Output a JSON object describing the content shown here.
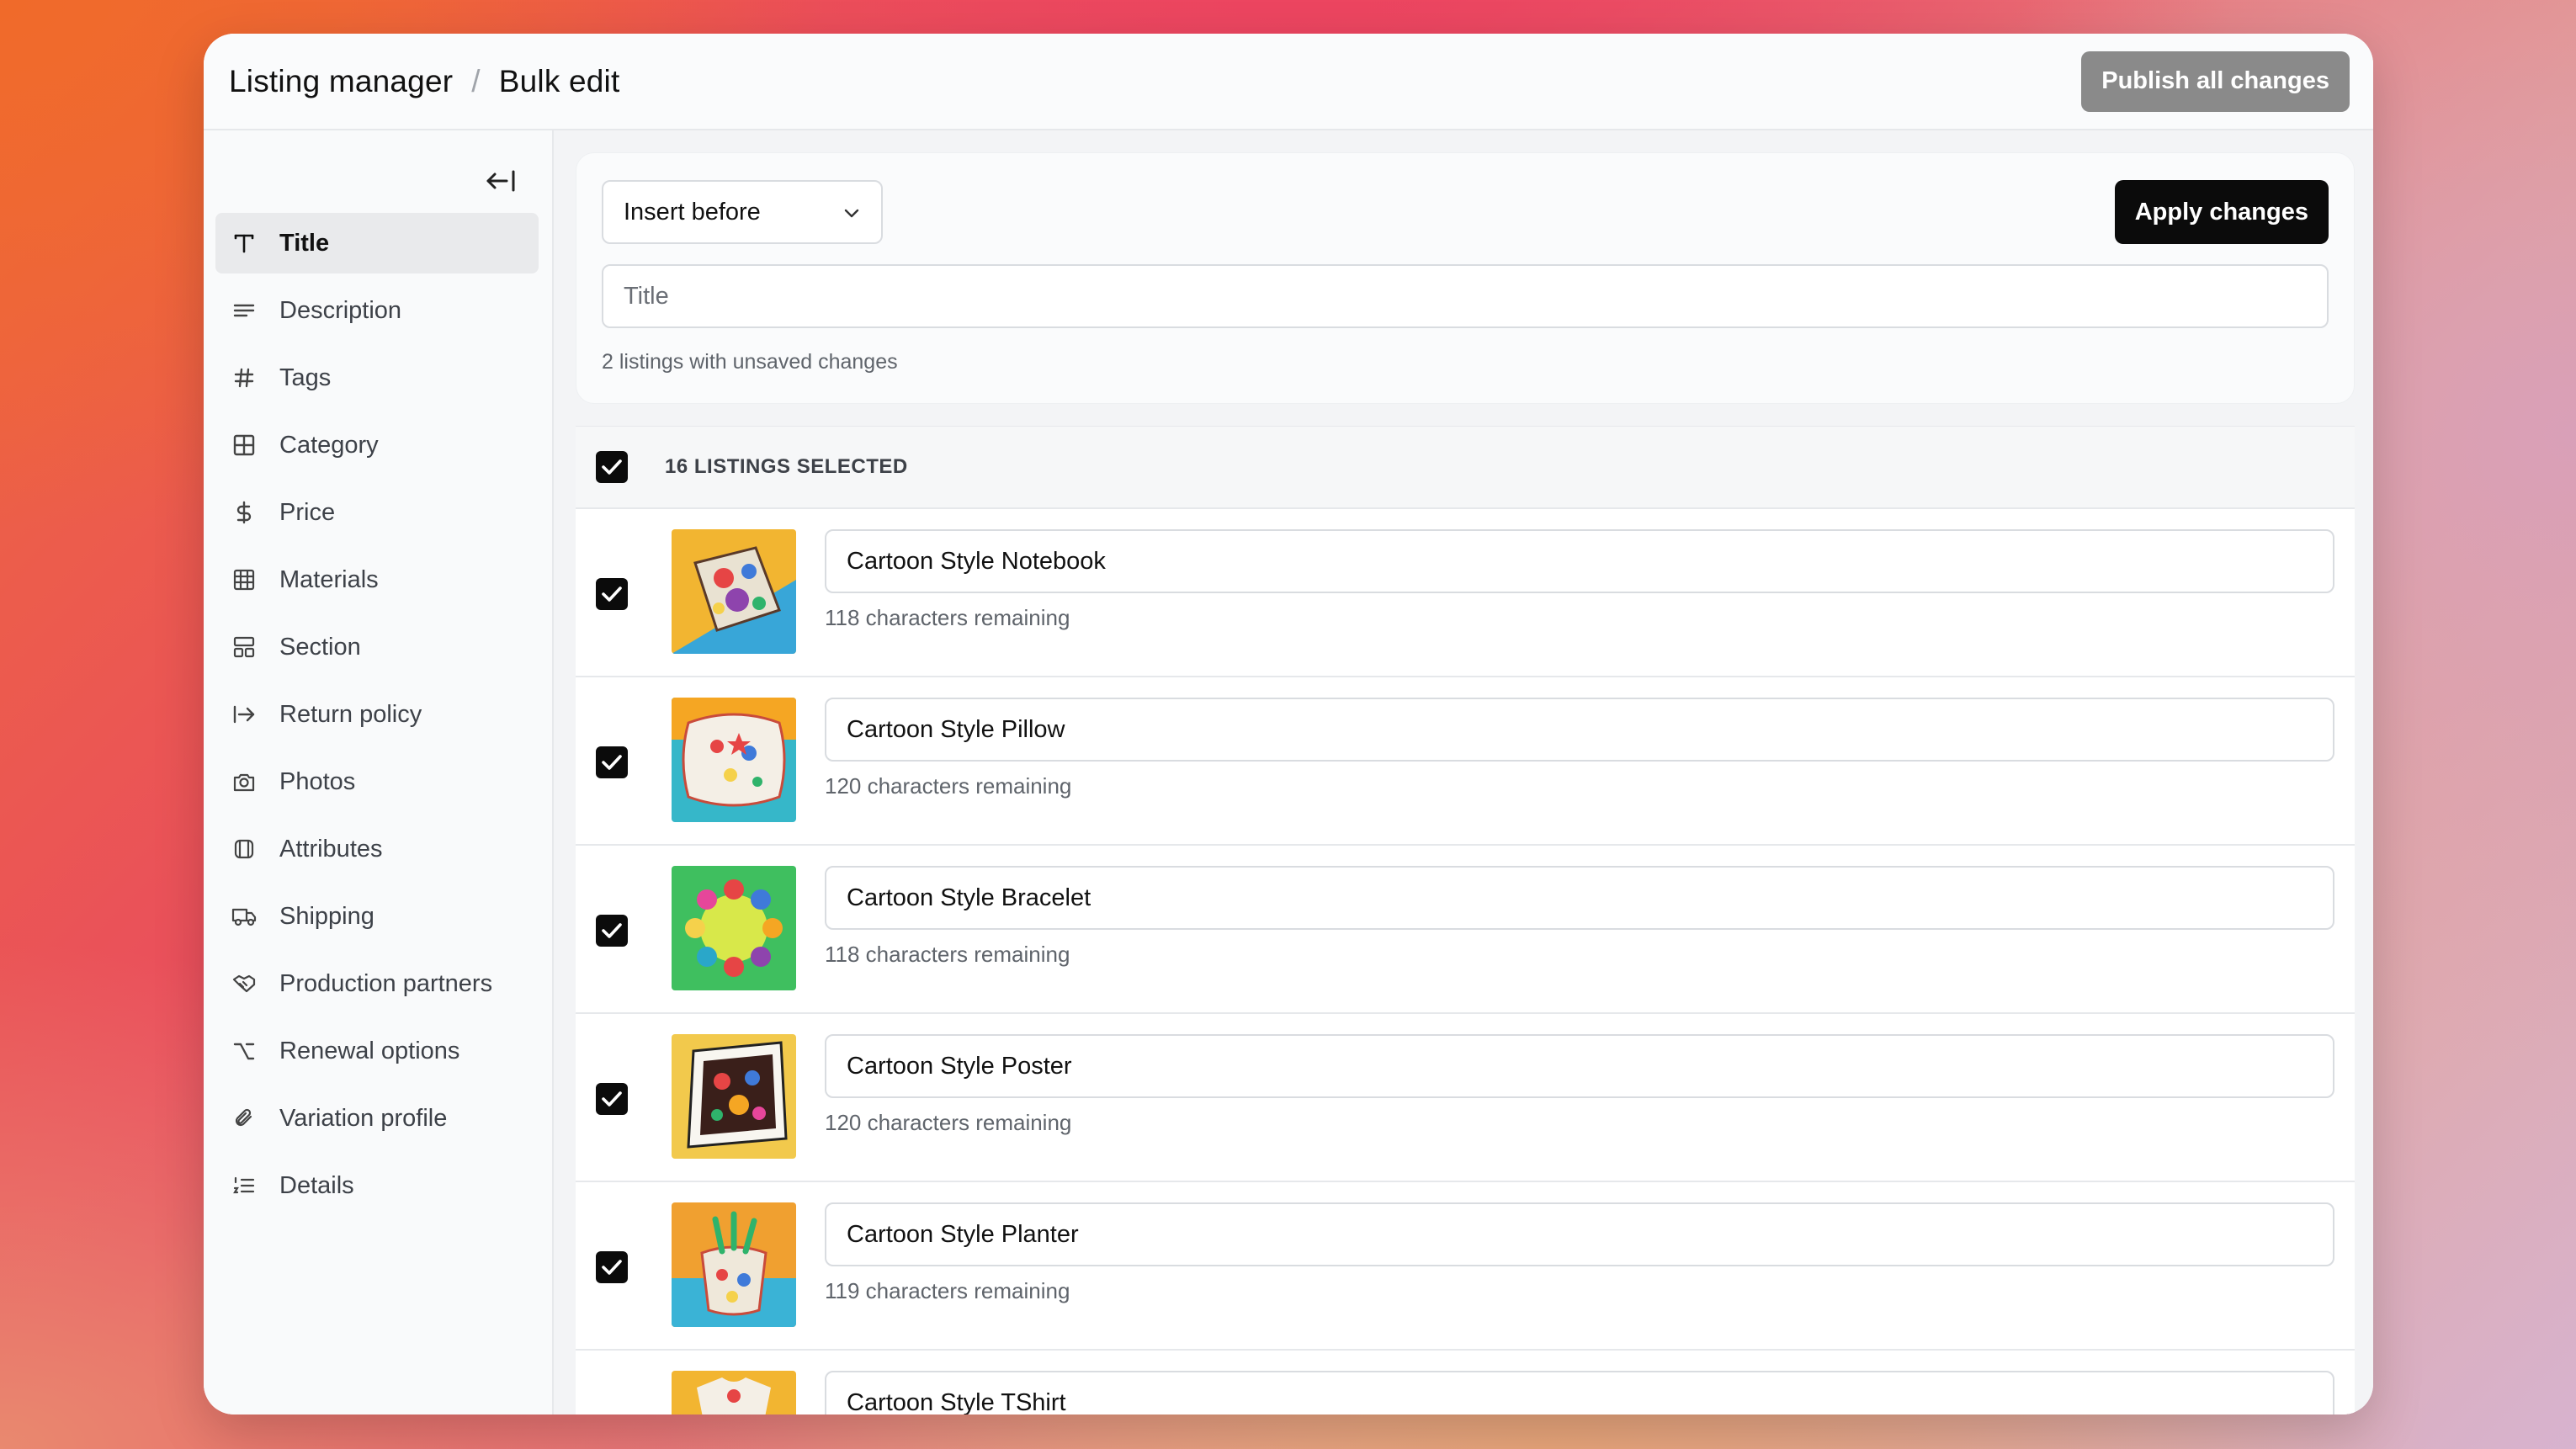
{
  "header": {
    "crumb_root": "Listing manager",
    "crumb_separator": "/",
    "crumb_current": "Bulk edit",
    "publish_label": "Publish all changes"
  },
  "sidebar": {
    "items": [
      {
        "label": "Title",
        "icon": "type-icon",
        "active": true
      },
      {
        "label": "Description",
        "icon": "align-left-icon"
      },
      {
        "label": "Tags",
        "icon": "hash-icon"
      },
      {
        "label": "Category",
        "icon": "grid-icon"
      },
      {
        "label": "Price",
        "icon": "dollar-icon"
      },
      {
        "label": "Materials",
        "icon": "table-icon"
      },
      {
        "label": "Section",
        "icon": "layout-icon"
      },
      {
        "label": "Return policy",
        "icon": "arrow-right-bar-icon"
      },
      {
        "label": "Photos",
        "icon": "camera-icon"
      },
      {
        "label": "Attributes",
        "icon": "cube-icon"
      },
      {
        "label": "Shipping",
        "icon": "truck-icon"
      },
      {
        "label": "Production partners",
        "icon": "handshake-icon"
      },
      {
        "label": "Renewal options",
        "icon": "option-icon"
      },
      {
        "label": "Variation profile",
        "icon": "paperclip-icon"
      },
      {
        "label": "Details",
        "icon": "list-ordered-icon"
      }
    ]
  },
  "editor": {
    "mode_value": "Insert before",
    "apply_label": "Apply changes",
    "title_placeholder": "Title",
    "unsaved_text": "2 listings with unsaved changes"
  },
  "listings": {
    "selected_label": "16 LISTINGS SELECTED",
    "rows": [
      {
        "title": "Cartoon Style Notebook",
        "remaining": "118 characters remaining"
      },
      {
        "title": "Cartoon Style Pillow",
        "remaining": "120 characters remaining"
      },
      {
        "title": "Cartoon Style Bracelet",
        "remaining": "118 characters remaining"
      },
      {
        "title": "Cartoon Style Poster",
        "remaining": "120 characters remaining"
      },
      {
        "title": "Cartoon Style Planter",
        "remaining": "119 characters remaining"
      },
      {
        "title": "Cartoon Style TShirt",
        "remaining": ""
      }
    ]
  },
  "colors": {
    "primary_button": "#0b0b0b",
    "publish_button": "#8a8a8a",
    "active_nav": "#e9eaec"
  }
}
